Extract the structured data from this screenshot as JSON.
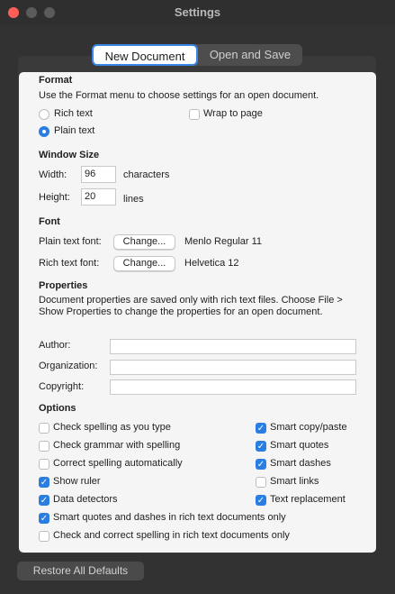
{
  "window": {
    "title": "Settings"
  },
  "tabs": [
    {
      "label": "New Document",
      "active": true
    },
    {
      "label": "Open and Save",
      "active": false
    }
  ],
  "format": {
    "heading": "Format",
    "description": "Use the Format menu to choose settings for an open document.",
    "rich_text_label": "Rich text",
    "plain_text_label": "Plain text",
    "wrap_label": "Wrap to page",
    "selected": "plain"
  },
  "window_size": {
    "heading": "Window Size",
    "width_label": "Width:",
    "width_value": "96",
    "width_unit": "characters",
    "height_label": "Height:",
    "height_value": "20",
    "height_unit": "lines"
  },
  "font": {
    "heading": "Font",
    "plain_label": "Plain text font:",
    "rich_label": "Rich text font:",
    "change_label": "Change...",
    "plain_font": "Menlo Regular 11",
    "rich_font": "Helvetica 12"
  },
  "properties": {
    "heading": "Properties",
    "description": "Document properties are saved only with rich text files. Choose File > Show Properties to change the properties for an open document.",
    "author_label": "Author:",
    "org_label": "Organization:",
    "copyright_label": "Copyright:",
    "author_value": "",
    "org_value": "",
    "copyright_value": ""
  },
  "options": {
    "heading": "Options",
    "left": [
      {
        "label": "Check spelling as you type",
        "checked": false
      },
      {
        "label": "Check grammar with spelling",
        "checked": false
      },
      {
        "label": "Correct spelling automatically",
        "checked": false
      },
      {
        "label": "Show ruler",
        "checked": true
      },
      {
        "label": "Data detectors",
        "checked": true
      }
    ],
    "right": [
      {
        "label": "Smart copy/paste",
        "checked": true
      },
      {
        "label": "Smart quotes",
        "checked": true
      },
      {
        "label": "Smart dashes",
        "checked": true
      },
      {
        "label": "Smart links",
        "checked": false
      },
      {
        "label": "Text replacement",
        "checked": true
      }
    ],
    "full": [
      {
        "label": "Smart quotes and dashes in rich text documents only",
        "checked": true
      },
      {
        "label": "Check and correct spelling in rich text documents only",
        "checked": false
      }
    ]
  },
  "footer": {
    "restore_label": "Restore All Defaults"
  },
  "icons": {
    "check": "✓"
  }
}
